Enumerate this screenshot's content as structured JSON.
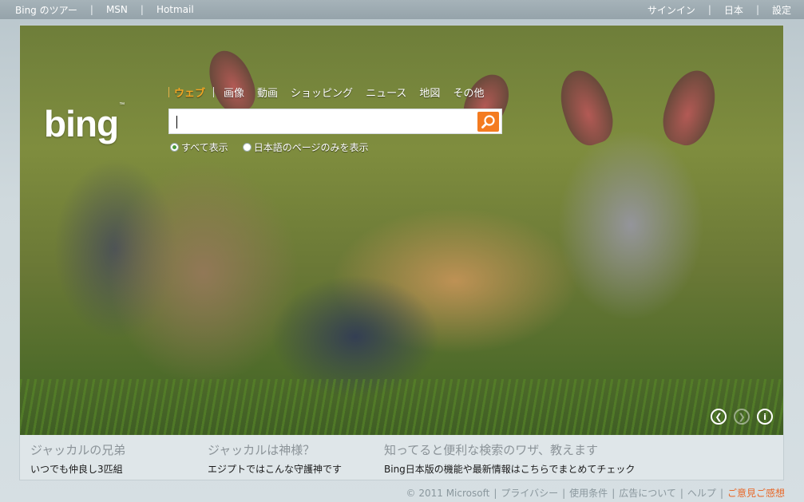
{
  "topbar": {
    "left": [
      "Bing のツアー",
      "MSN",
      "Hotmail"
    ],
    "right": [
      "サインイン",
      "日本",
      "設定"
    ],
    "separator": "|"
  },
  "logo": {
    "text": "bing",
    "tm": "™"
  },
  "scopes": [
    "ウェブ",
    "画像",
    "動画",
    "ショッピング",
    "ニュース",
    "地図",
    "その他"
  ],
  "search": {
    "value": "",
    "placeholder": ""
  },
  "radios": [
    {
      "label": "すべて表示",
      "selected": true
    },
    {
      "label": "日本語のページのみを表示",
      "selected": false
    }
  ],
  "hotspots": [
    {
      "title": "ジャッカルの兄弟",
      "subtitle": "いつでも仲良し3匹組"
    },
    {
      "title": "ジャッカルは神様？",
      "subtitle": "エジプトではこんな守護神です"
    },
    {
      "title": "知ってると便利な検索のワザ、教えます",
      "subtitle": "Bing日本版の機能や最新情報はこちらでまとめてチェック"
    }
  ],
  "hero_icons": [
    "prev-icon",
    "next-icon",
    "info-icon"
  ],
  "footer": {
    "items": [
      "© 2011 Microsoft",
      "プライバシー",
      "使用条件",
      "広告について",
      "ヘルプ"
    ],
    "feedback": "ご意見ご感想",
    "separator": "|"
  },
  "colors": {
    "accent": "#f47b20",
    "scope_active": "#f5a623",
    "feedback": "#e8692a"
  }
}
